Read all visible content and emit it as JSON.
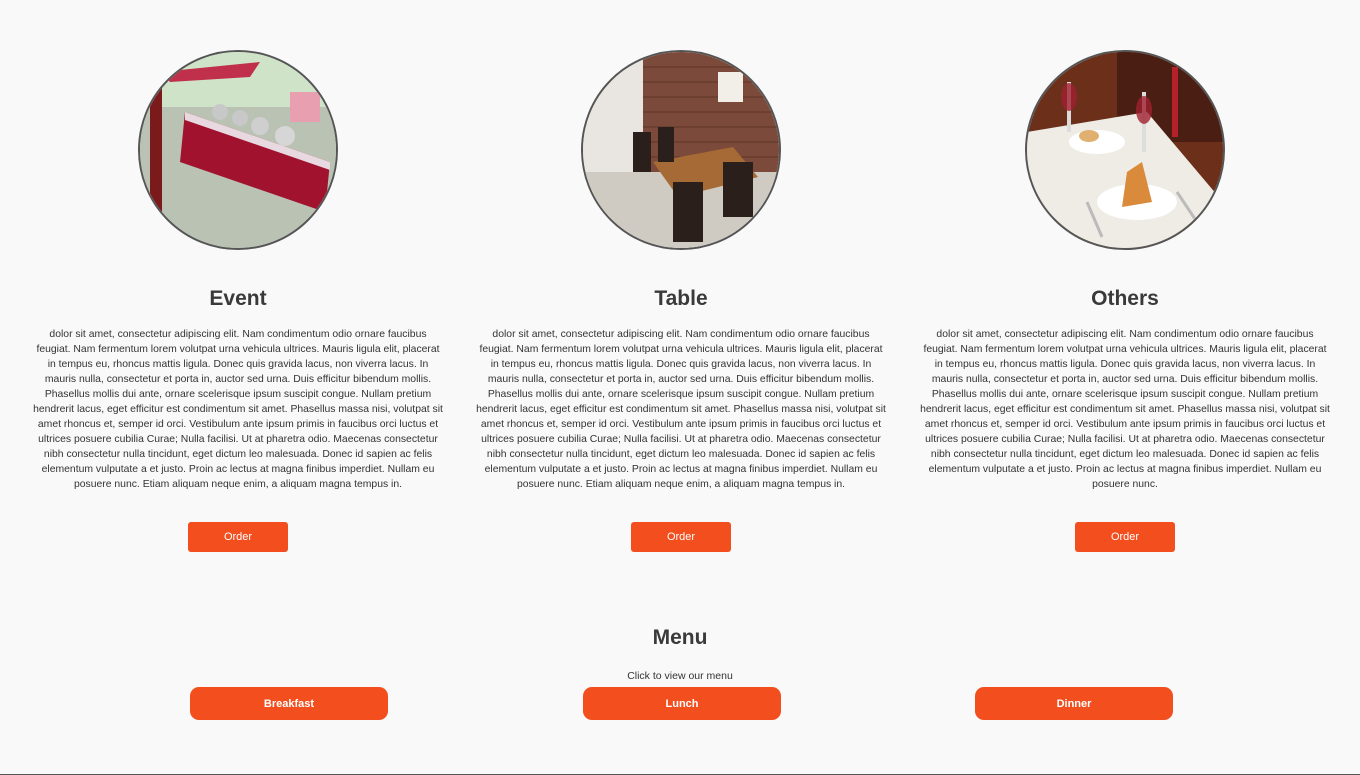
{
  "cards": [
    {
      "title": "Event",
      "text": "dolor sit amet, consectetur adipiscing elit. Nam condimentum odio ornare faucibus feugiat. Nam fermentum lorem volutpat urna vehicula ultrices. Mauris ligula elit, placerat in tempus eu, rhoncus mattis ligula. Donec quis gravida lacus, non viverra lacus. In mauris nulla, consectetur et porta in, auctor sed urna. Duis efficitur bibendum mollis. Phasellus mollis dui ante, ornare scelerisque ipsum suscipit congue. Nullam pretium hendrerit lacus, eget efficitur est condimentum sit amet. Phasellus massa nisi, volutpat sit amet rhoncus et, semper id orci. Vestibulum ante ipsum primis in faucibus orci luctus et ultrices posuere cubilia Curae; Nulla facilisi. Ut at pharetra odio. Maecenas consectetur nibh consectetur nulla tincidunt, eget dictum leo malesuada. Donec id sapien ac felis elementum vulputate a et justo. Proin ac lectus at magna finibus imperdiet. Nullam eu posuere nunc. Etiam aliquam neque enim, a aliquam magna tempus in.",
      "button": "Order"
    },
    {
      "title": "Table",
      "text": "dolor sit amet, consectetur adipiscing elit. Nam condimentum odio ornare faucibus feugiat. Nam fermentum lorem volutpat urna vehicula ultrices. Mauris ligula elit, placerat in tempus eu, rhoncus mattis ligula. Donec quis gravida lacus, non viverra lacus. In mauris nulla, consectetur et porta in, auctor sed urna. Duis efficitur bibendum mollis. Phasellus mollis dui ante, ornare scelerisque ipsum suscipit congue. Nullam pretium hendrerit lacus, eget efficitur est condimentum sit amet. Phasellus massa nisi, volutpat sit amet rhoncus et, semper id orci. Vestibulum ante ipsum primis in faucibus orci luctus et ultrices posuere cubilia Curae; Nulla facilisi. Ut at pharetra odio. Maecenas consectetur nibh consectetur nulla tincidunt, eget dictum leo malesuada. Donec id sapien ac felis elementum vulputate a et justo. Proin ac lectus at magna finibus imperdiet. Nullam eu posuere nunc. Etiam aliquam neque enim, a aliquam magna tempus in.",
      "button": "Order"
    },
    {
      "title": "Others",
      "text": "dolor sit amet, consectetur adipiscing elit. Nam condimentum odio ornare faucibus feugiat. Nam fermentum lorem volutpat urna vehicula ultrices. Mauris ligula elit, placerat in tempus eu, rhoncus mattis ligula. Donec quis gravida lacus, non viverra lacus. In mauris nulla, consectetur et porta in, auctor sed urna. Duis efficitur bibendum mollis. Phasellus mollis dui ante, ornare scelerisque ipsum suscipit congue. Nullam pretium hendrerit lacus, eget efficitur est condimentum sit amet. Phasellus massa nisi, volutpat sit amet rhoncus et, semper id orci. Vestibulum ante ipsum primis in faucibus orci luctus et ultrices posuere cubilia Curae; Nulla facilisi. Ut at pharetra odio. Maecenas consectetur nibh consectetur nulla tincidunt, eget dictum leo malesuada. Donec id sapien ac felis elementum vulputate a et justo. Proin ac lectus at magna finibus imperdiet. Nullam eu posuere nunc.",
      "button": "Order"
    }
  ],
  "menu": {
    "title": "Menu",
    "subtitle": "Click to view our menu",
    "buttons": [
      "Breakfast",
      "Lunch",
      "Dinner"
    ]
  },
  "colors": {
    "accent": "#f24e1e",
    "background": "#f9f9f9",
    "heading": "#3a3a3a"
  }
}
